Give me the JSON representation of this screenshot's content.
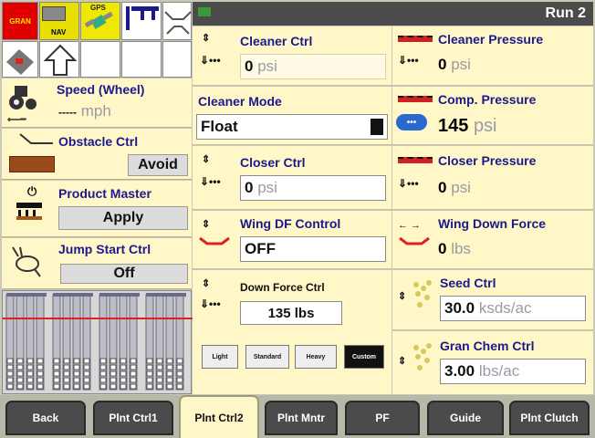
{
  "header": {
    "run_label": "Run 2"
  },
  "status_icons": {
    "gran": "GRAN",
    "nav": "NAV",
    "gps": "GPS"
  },
  "left": {
    "speed": {
      "label": "Speed (Wheel)",
      "value": "-----",
      "unit": "mph"
    },
    "obstacle": {
      "label": "Obstacle Ctrl",
      "button": "Avoid"
    },
    "product_master": {
      "label": "Product Master",
      "button": "Apply"
    },
    "jump_start": {
      "label": "Jump Start Ctrl",
      "button": "Off"
    }
  },
  "middle": {
    "cleaner_ctrl": {
      "label": "Cleaner Ctrl",
      "value": "0",
      "unit": "psi"
    },
    "cleaner_mode": {
      "label": "Cleaner Mode",
      "value": "Float"
    },
    "closer_ctrl": {
      "label": "Closer Ctrl",
      "value": "0",
      "unit": "psi"
    },
    "wing_df_control": {
      "label": "Wing DF Control",
      "value": "OFF"
    },
    "down_force_ctrl": {
      "label": "Down Force Ctrl",
      "value": "135 lbs"
    },
    "presets": [
      "Light",
      "Standard",
      "Heavy",
      "Custom"
    ]
  },
  "right": {
    "cleaner_pressure": {
      "label": "Cleaner Pressure",
      "value": "0",
      "unit": "psi"
    },
    "comp_pressure": {
      "label": "Comp. Pressure",
      "value": "145",
      "unit": "psi"
    },
    "closer_pressure": {
      "label": "Closer Pressure",
      "value": "0",
      "unit": "psi"
    },
    "wing_down_force": {
      "label": "Wing Down Force",
      "value": "0",
      "unit": "lbs"
    },
    "seed_ctrl": {
      "label": "Seed Ctrl",
      "value": "30.0",
      "unit": "ksds/ac"
    },
    "gran_chem_ctrl": {
      "label": "Gran Chem Ctrl",
      "value": "3.00",
      "unit": "lbs/ac"
    }
  },
  "tabs": [
    "Back",
    "Plnt Ctrl1",
    "Plnt Ctrl2",
    "Plnt Mntr",
    "PF",
    "Guide",
    "Plnt Clutch"
  ],
  "active_tab": "Plnt Ctrl2",
  "colors": {
    "panel_bg": "#fff7c8",
    "label_blue": "#1a1a8c",
    "header_bg": "#4b4b4b",
    "active_preset": "#111111"
  }
}
